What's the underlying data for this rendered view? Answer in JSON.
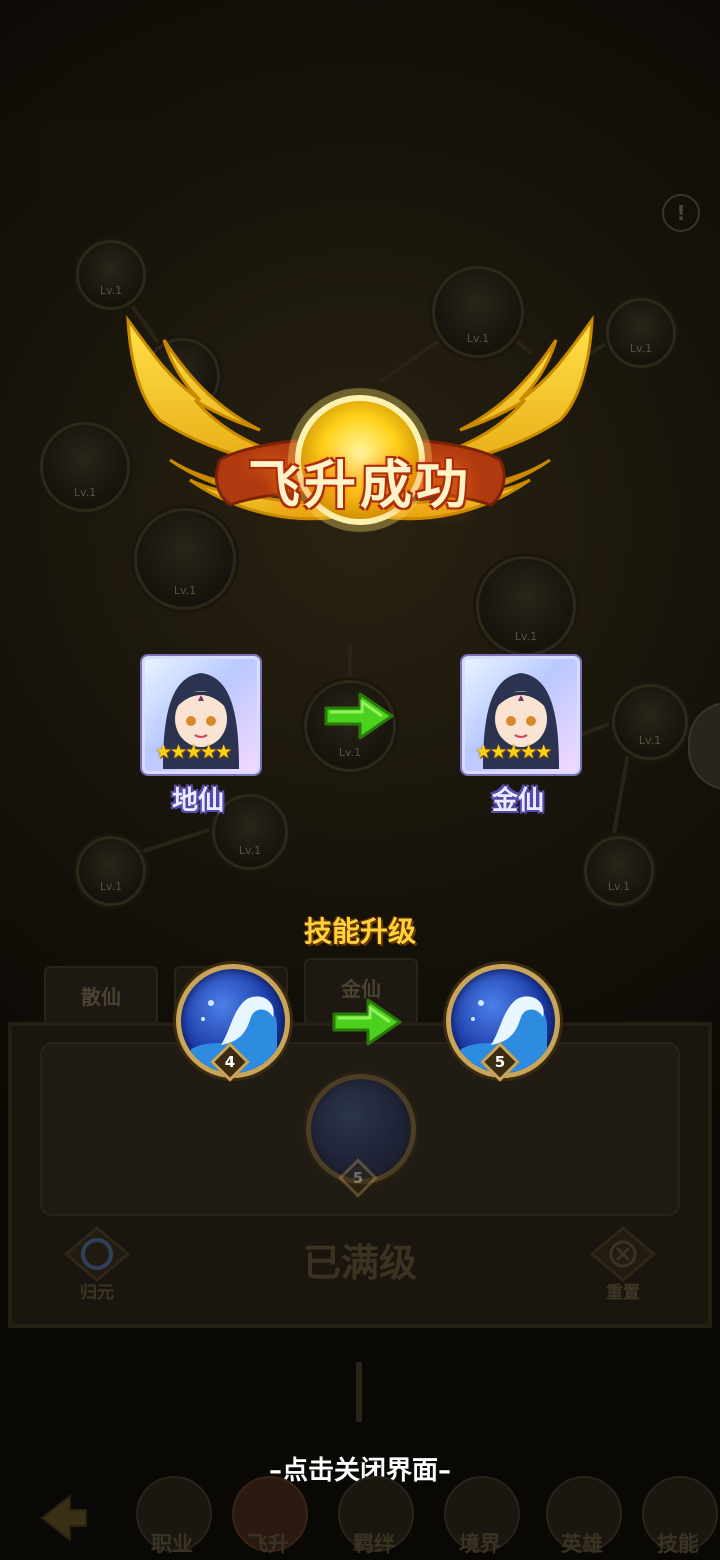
{
  "popup": {
    "title": "飞升成功",
    "from_rank": "地仙",
    "to_rank": "金仙",
    "skill_upgrade_title": "技能升级",
    "skill_from_level": "4",
    "skill_to_level": "5",
    "close_hint": "–点击关闭界面–"
  },
  "background": {
    "node_level_label": "Lv.1",
    "tabs": [
      "散仙",
      "",
      "金仙"
    ],
    "panel_skill_level": "5",
    "maxed_text": "已满级",
    "left_button": "归元",
    "right_button": "重置",
    "alert_glyph": "!"
  },
  "nav": {
    "items": [
      "职业",
      "飞升",
      "羁绊",
      "境界",
      "英雄",
      "技能"
    ]
  },
  "colors": {
    "title_text": "#fff3c8",
    "title_outline": "#a52a08",
    "skill_title": "#ffd23a",
    "rank_text": "#e9ecff",
    "arrow": "#4cd11f",
    "star": "#ffd21a"
  },
  "hero": {
    "stars": "★★★★★"
  }
}
